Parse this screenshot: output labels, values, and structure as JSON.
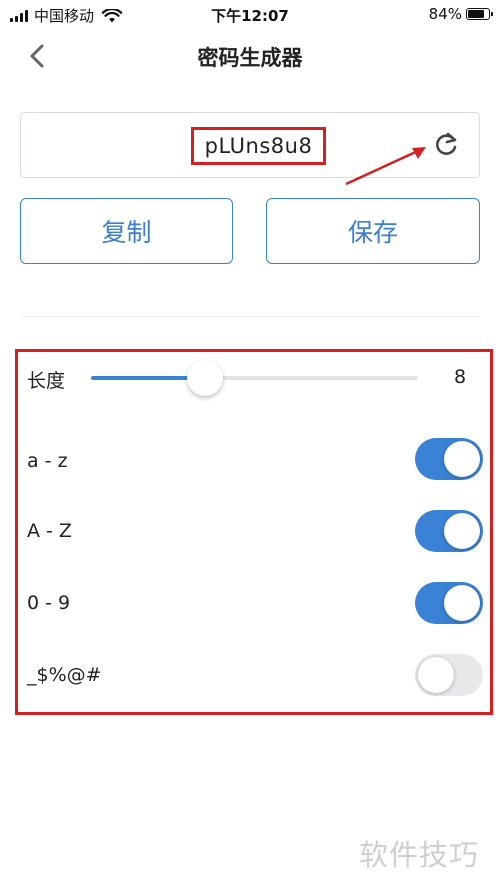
{
  "status_bar": {
    "carrier": "中国移动",
    "time": "下午12:07",
    "battery": "84%",
    "battery_level": 0.84
  },
  "nav": {
    "title": "密码生成器",
    "back_icon": "chevron-left-icon"
  },
  "generator": {
    "password": "pLUns8u8",
    "refresh_icon": "refresh-icon"
  },
  "actions": {
    "copy_label": "复制",
    "save_label": "保存"
  },
  "settings": {
    "length_label": "长度",
    "length_value": "8",
    "length_fraction": 0.35,
    "options": [
      {
        "label": "a - z",
        "enabled": true
      },
      {
        "label": "A - Z",
        "enabled": true
      },
      {
        "label": "0 - 9",
        "enabled": true
      },
      {
        "label": "_$%@#",
        "enabled": false
      }
    ]
  },
  "colors": {
    "accent": "#3a82d6",
    "annotation": "#d42020"
  },
  "watermark": "软件技巧"
}
